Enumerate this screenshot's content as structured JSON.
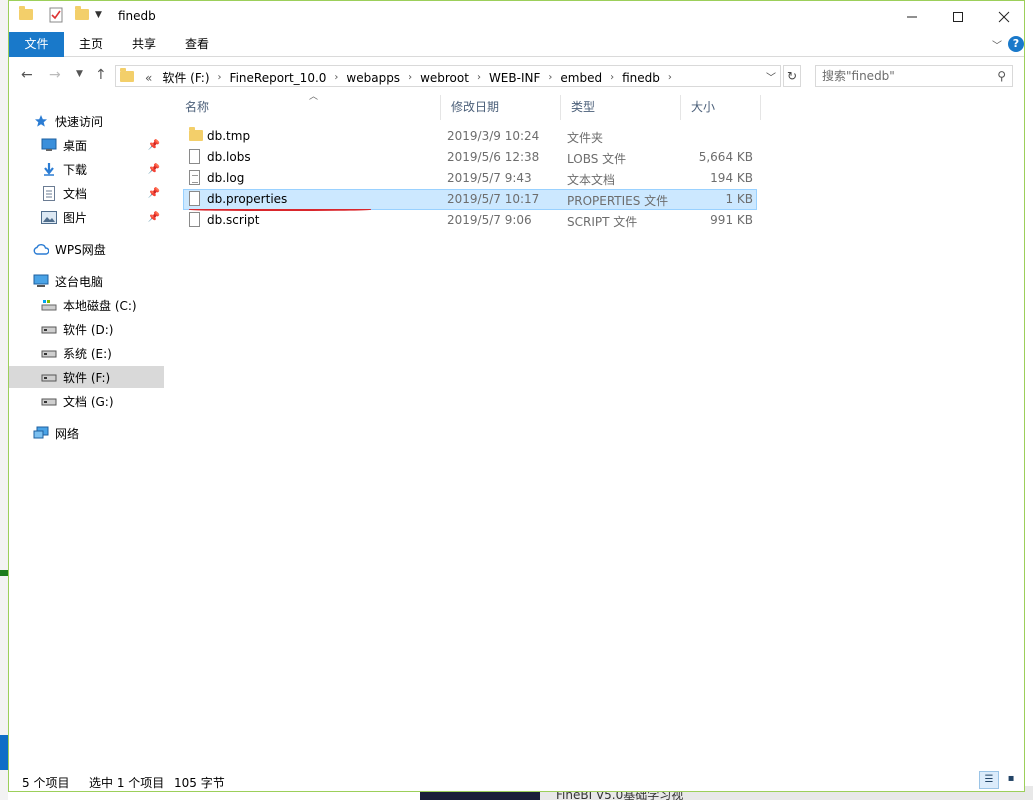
{
  "window": {
    "title": "finedb",
    "accent": "#1979ca"
  },
  "ribbon": {
    "tabs": [
      "文件",
      "主页",
      "共享",
      "查看"
    ]
  },
  "address": {
    "overflow": "«",
    "crumbs": [
      "软件 (F:)",
      "FineReport_10.0",
      "webapps",
      "webroot",
      "WEB-INF",
      "embed",
      "finedb"
    ]
  },
  "search": {
    "placeholder": "搜索\"finedb\""
  },
  "sidebar": {
    "items": [
      {
        "label": "快速访问",
        "icon": "star-icon"
      },
      {
        "label": "桌面",
        "icon": "desktop-icon",
        "pinned": true
      },
      {
        "label": "下载",
        "icon": "download-icon",
        "pinned": true
      },
      {
        "label": "文档",
        "icon": "document-icon",
        "pinned": true
      },
      {
        "label": "图片",
        "icon": "picture-icon",
        "pinned": true
      },
      {
        "label": "WPS网盘",
        "icon": "cloud-icon"
      },
      {
        "label": "这台电脑",
        "icon": "computer-icon"
      },
      {
        "label": "本地磁盘 (C:)",
        "icon": "drive-icon"
      },
      {
        "label": "软件 (D:)",
        "icon": "drive-icon"
      },
      {
        "label": "系统 (E:)",
        "icon": "drive-icon"
      },
      {
        "label": "软件 (F:)",
        "icon": "drive-icon",
        "selected": true
      },
      {
        "label": "文档 (G:)",
        "icon": "drive-icon"
      },
      {
        "label": "网络",
        "icon": "network-icon"
      }
    ]
  },
  "columns": [
    "名称",
    "修改日期",
    "类型",
    "大小"
  ],
  "files": [
    {
      "name": "db.tmp",
      "date": "2019/3/9 10:24",
      "type": "文件夹",
      "size": "",
      "icon": "folder-icon"
    },
    {
      "name": "db.lobs",
      "date": "2019/5/6 12:38",
      "type": "LOBS 文件",
      "size": "5,664 KB",
      "icon": "file-icon"
    },
    {
      "name": "db.log",
      "date": "2019/5/7 9:43",
      "type": "文本文档",
      "size": "194 KB",
      "icon": "text-file-icon"
    },
    {
      "name": "db.properties",
      "date": "2019/5/7 10:17",
      "type": "PROPERTIES 文件",
      "size": "1 KB",
      "icon": "file-icon",
      "selected": true
    },
    {
      "name": "db.script",
      "date": "2019/5/7 9:06",
      "type": "SCRIPT 文件",
      "size": "991 KB",
      "icon": "file-icon"
    }
  ],
  "status": {
    "count": "5 个项目",
    "selection": "选中 1 个项目",
    "size": "105 字节"
  },
  "background": {
    "taskbar_text": "FineBI V5.0基础学习视"
  }
}
